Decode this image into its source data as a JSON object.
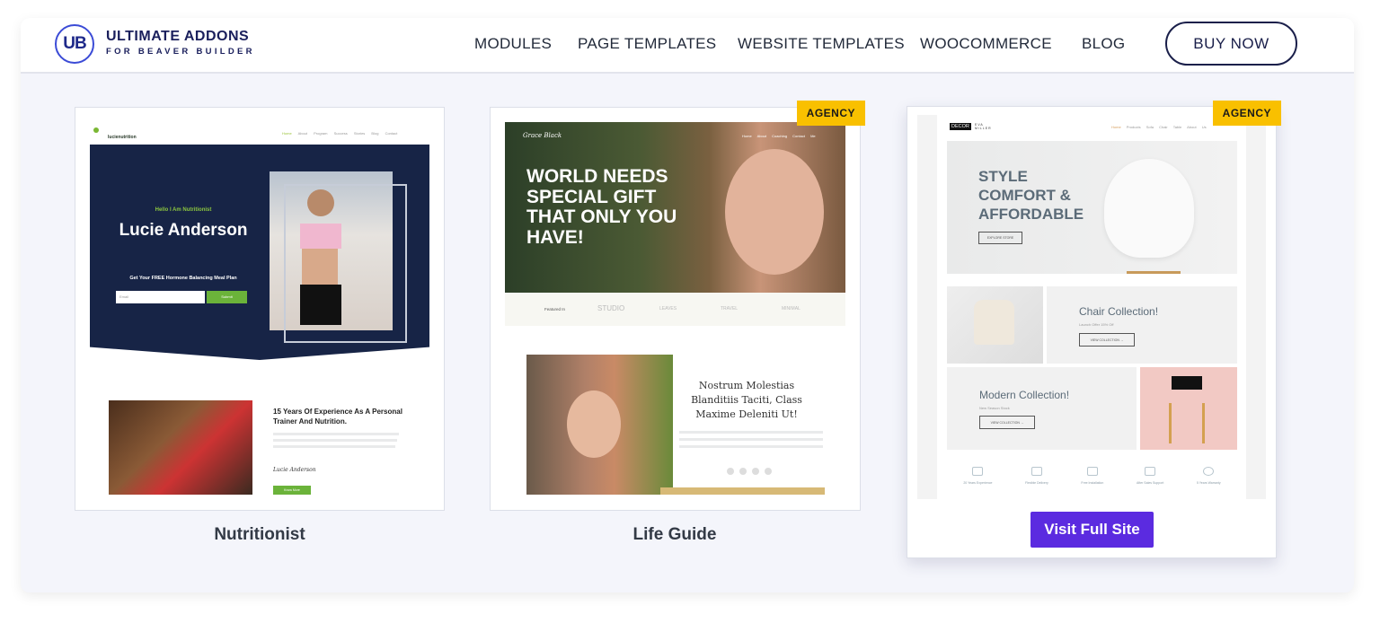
{
  "header": {
    "logo": {
      "mark": "UB",
      "line1": "ULTIMATE ADDONS",
      "line2": "FOR BEAVER BUILDER"
    },
    "nav": [
      "MODULES",
      "PAGE TEMPLATES",
      "WEBSITE TEMPLATES",
      "WOOCOMMERCE",
      "BLOG"
    ],
    "cta": "BUY NOW"
  },
  "colors": {
    "accent": "#5b2be0",
    "badge": "#f9c000",
    "navy": "#1a1f5c"
  },
  "templates": [
    {
      "name": "Nutritionist",
      "badge": "",
      "preview": {
        "logo": "lucienutrition",
        "nav": [
          "Home",
          "About",
          "Program",
          "Success Stories",
          "Blog",
          "Contact"
        ],
        "kicker": "Hello I Am Nutritionist",
        "title": "Lucie Anderson",
        "cta_heading": "Get Your FREE Hormone Balancing Meal Plan",
        "email_placeholder": "Email",
        "submit": "Submit",
        "section_title": "15 Years Of Experience As A Personal Trainer And Nutrition.",
        "signature": "Lucie Anderson",
        "button": "Know More"
      }
    },
    {
      "name": "Life Guide",
      "badge": "AGENCY",
      "preview": {
        "logo": "Grace Black",
        "nav": [
          "Home",
          "About",
          "Coaching",
          "Contact Me"
        ],
        "title": "WORLD NEEDS SPECIAL GIFT THAT ONLY YOU HAVE!",
        "featured": "Featured In",
        "brands": [
          "STUDIO",
          "LEAVES",
          "TRAVEL",
          "MINIMAL"
        ],
        "section_title": "Nostrum Molestias Blanditiis Taciti, Class Maxime Deleniti Ut!"
      }
    },
    {
      "name": "",
      "badge": "AGENCY",
      "action": "Visit Full Site",
      "preview": {
        "logo": "DECOR",
        "logo_sub": "EVA MILLER",
        "nav": [
          "Home",
          "Products",
          "Sofa",
          "Chair",
          "Table",
          "About Us"
        ],
        "title": "STYLE COMFORT & AFFORDABLE",
        "hero_button": "EXPLORE STORE",
        "chair_title": "Chair Collection!",
        "chair_sub": "Launch Offer 15% Off",
        "chair_button": "VIEW COLLECTION →",
        "modern_title": "Modern Collection!",
        "modern_sub": "New Season Stock",
        "modern_button": "VIEW COLLECTION →",
        "features": [
          "20 Years Experience",
          "Flexible Delivery",
          "Free Installation",
          "After Sales Support",
          "5 Years Warranty"
        ]
      }
    }
  ]
}
